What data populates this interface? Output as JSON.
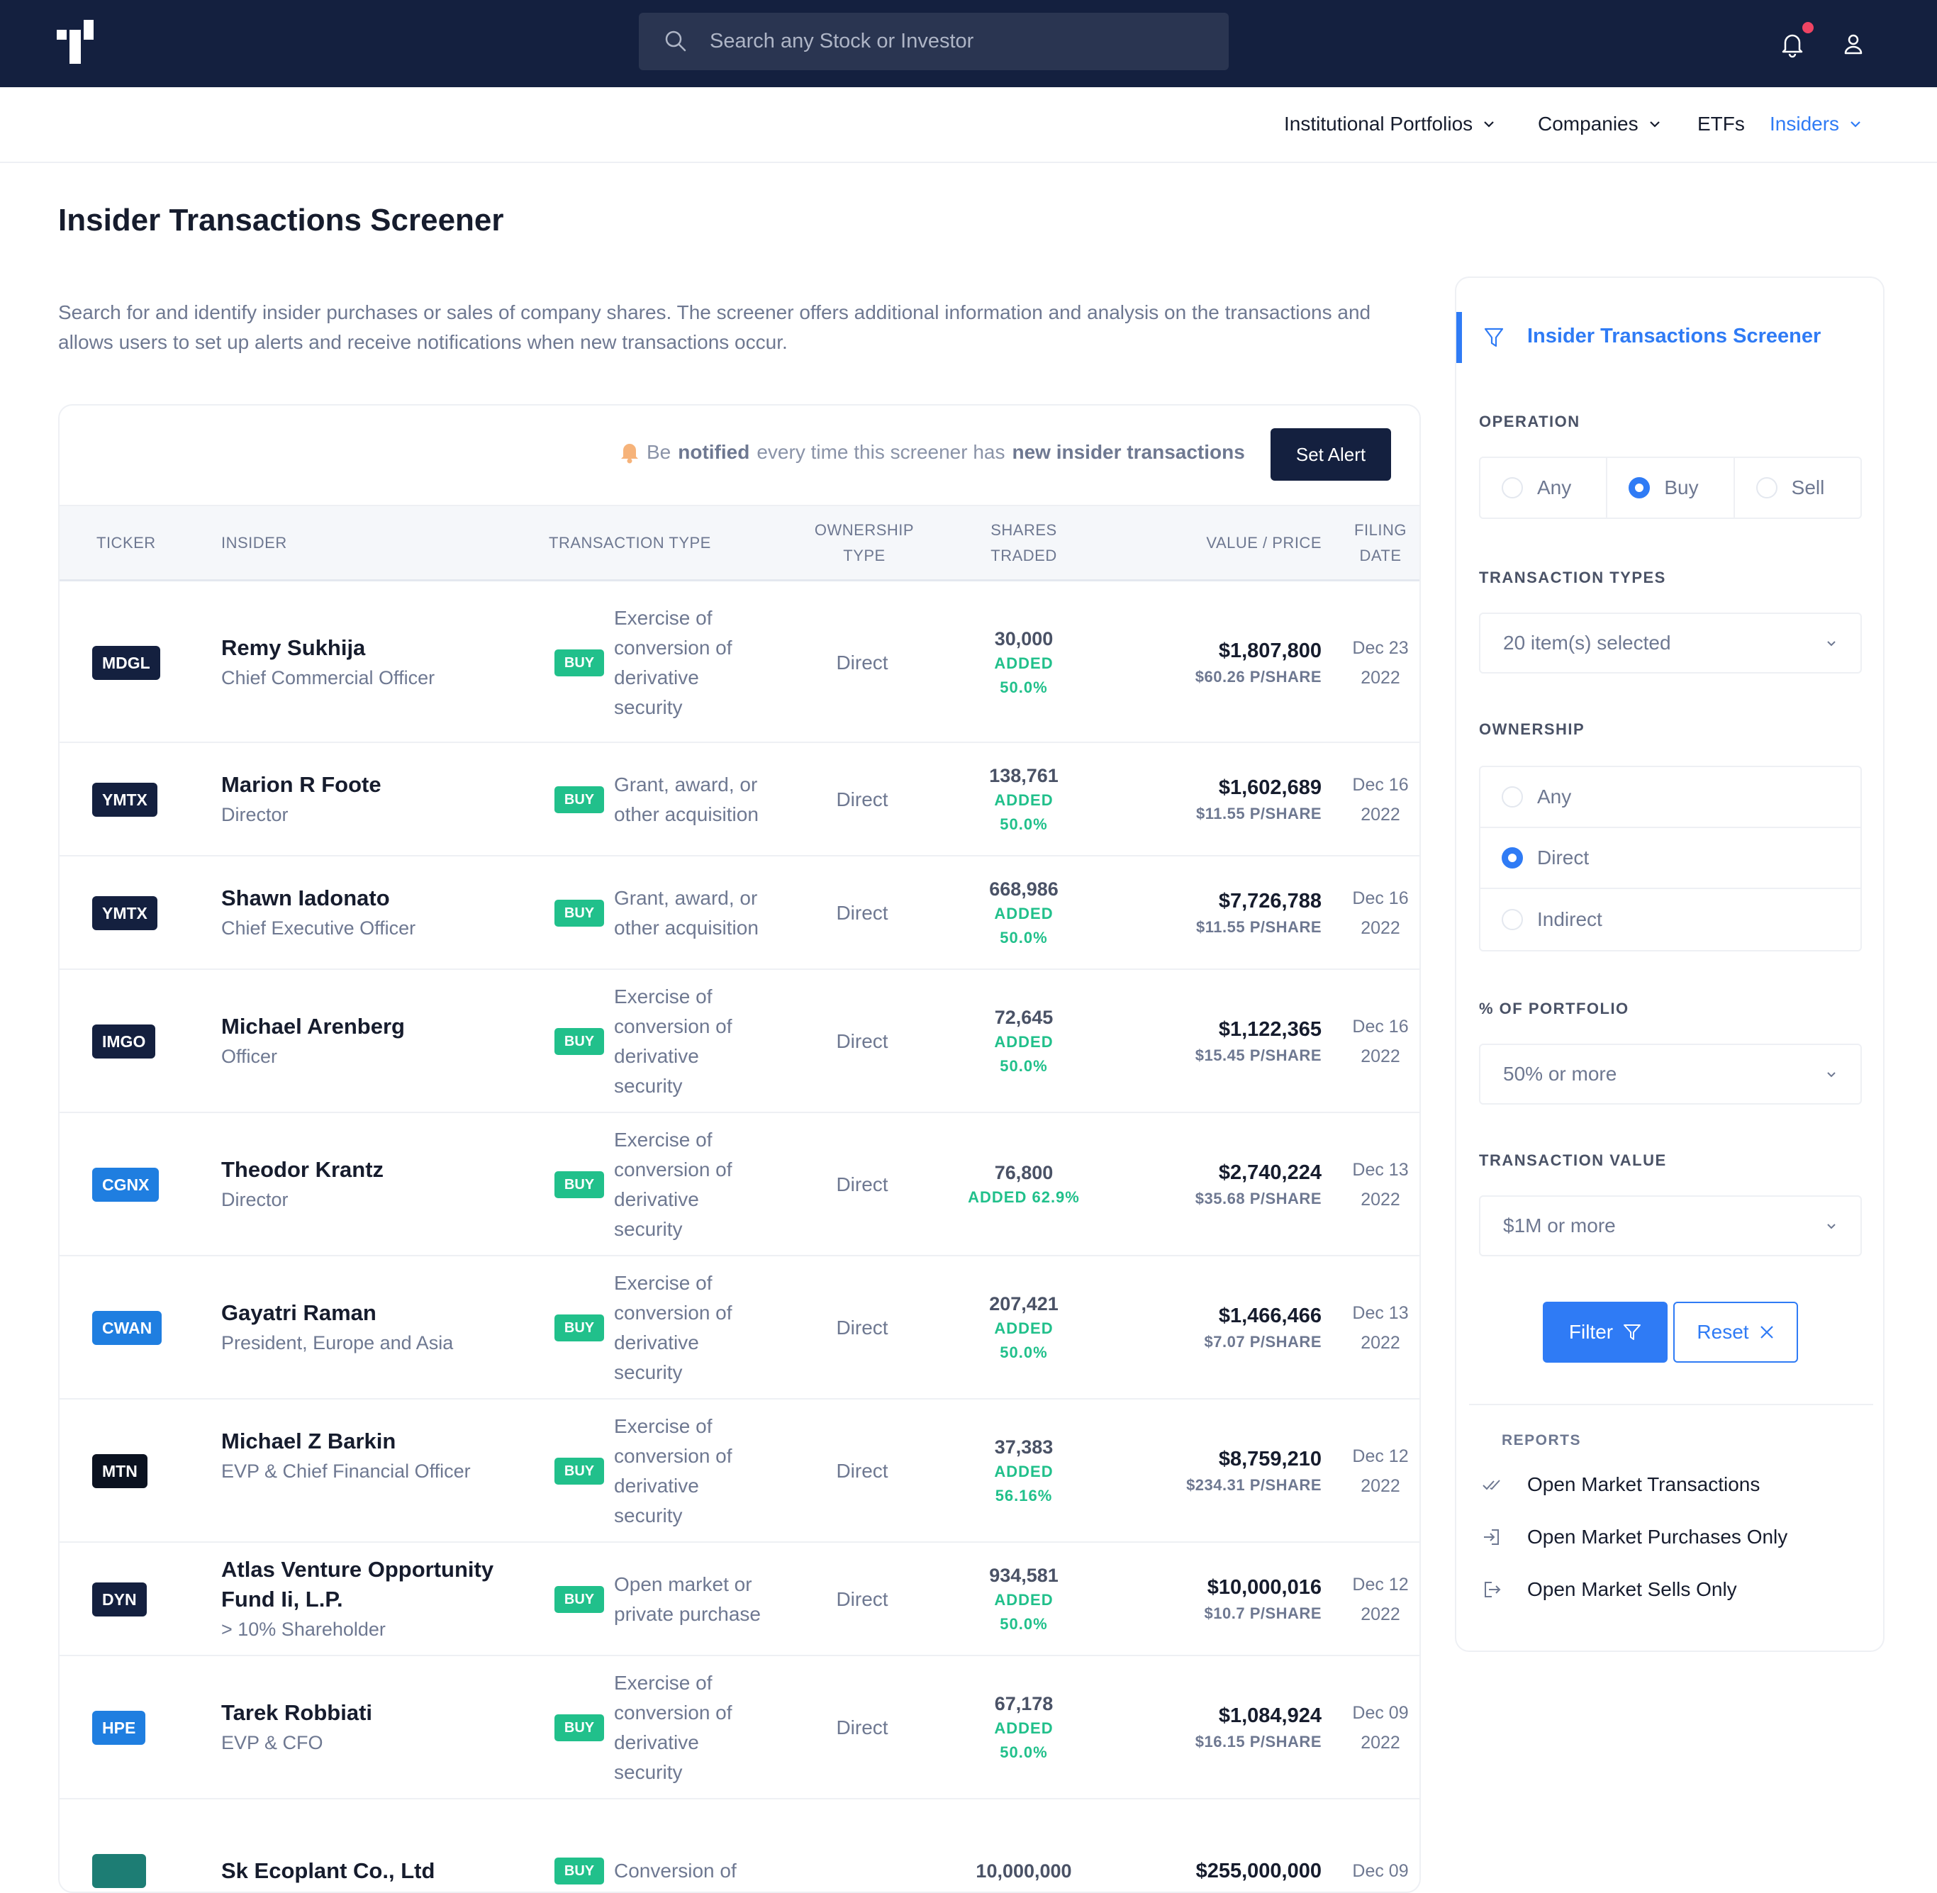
{
  "header": {
    "search_placeholder": "Search any Stock or Investor",
    "icons": [
      "logo-icon",
      "search-icon",
      "bell-icon",
      "user-icon"
    ]
  },
  "nav": {
    "items": [
      {
        "label": "Institutional Portfolios",
        "dropdown": true
      },
      {
        "label": "Companies",
        "dropdown": true
      },
      {
        "label": "ETFs",
        "dropdown": false
      },
      {
        "label": "Insiders",
        "dropdown": true,
        "active": true
      }
    ]
  },
  "page": {
    "title": "Insider Transactions Screener",
    "intro": "Search for and identify insider purchases or sales of company shares. The screener offers additional information and analysis on the transactions and allows users to set up alerts and receive notifications when new transactions occur."
  },
  "alert": {
    "p1": "Be",
    "b1": "notified",
    "p2": "every time this screener has",
    "b2": "new insider transactions",
    "button": "Set Alert"
  },
  "table": {
    "headers": {
      "ticker": "TICKER",
      "insider": "INSIDER",
      "transaction_type": "TRANSACTION TYPE",
      "ownership_1": "OWNERSHIP",
      "ownership_2": "TYPE",
      "shares_1": "SHARES",
      "shares_2": "TRADED",
      "value": "VALUE / PRICE",
      "filing_1": "FILING",
      "filing_2": "DATE"
    },
    "rows": [
      {
        "ticker": "MDGL",
        "color": "#14203f",
        "name": "Remy Sukhija",
        "title": "Chief Commercial Officer",
        "type": "Exercise of conversion of derivative security",
        "ownership": "Direct",
        "shares": "30,000",
        "chg1": "ADDED",
        "chg2": "50.0%",
        "value": "$1,807,800",
        "price": "$60.26 P/SHARE",
        "date1": "Dec 23",
        "date2": "2022"
      },
      {
        "ticker": "YMTX",
        "color": "#14203f",
        "name": "Marion R Foote",
        "title": "Director",
        "type": "Grant, award, or other acquisition",
        "ownership": "Direct",
        "shares": "138,761",
        "chg1": "ADDED",
        "chg2": "50.0%",
        "value": "$1,602,689",
        "price": "$11.55 P/SHARE",
        "date1": "Dec 16",
        "date2": "2022"
      },
      {
        "ticker": "YMTX",
        "color": "#14203f",
        "name": "Shawn Iadonato",
        "title": "Chief Executive Officer",
        "type": "Grant, award, or other acquisition",
        "ownership": "Direct",
        "shares": "668,986",
        "chg1": "ADDED",
        "chg2": "50.0%",
        "value": "$7,726,788",
        "price": "$11.55 P/SHARE",
        "date1": "Dec 16",
        "date2": "2022"
      },
      {
        "ticker": "IMGO",
        "color": "#14203f",
        "name": "Michael Arenberg",
        "title": "Officer",
        "type": "Exercise of conversion of derivative security",
        "ownership": "Direct",
        "shares": "72,645",
        "chg1": "ADDED",
        "chg2": "50.0%",
        "value": "$1,122,365",
        "price": "$15.45 P/SHARE",
        "date1": "Dec 16",
        "date2": "2022"
      },
      {
        "ticker": "CGNX",
        "color": "#1f7ee0",
        "name": "Theodor Krantz",
        "title": "Director",
        "type": "Exercise of conversion of derivative security",
        "ownership": "Direct",
        "shares": "76,800",
        "chg1": "ADDED 62.9%",
        "chg2": "",
        "value": "$2,740,224",
        "price": "$35.68 P/SHARE",
        "date1": "Dec 13",
        "date2": "2022"
      },
      {
        "ticker": "CWAN",
        "color": "#1f7ee0",
        "name": "Gayatri Raman",
        "title": "President, Europe and Asia",
        "type": "Exercise of conversion of derivative security",
        "ownership": "Direct",
        "shares": "207,421",
        "chg1": "ADDED",
        "chg2": "50.0%",
        "value": "$1,466,466",
        "price": "$7.07 P/SHARE",
        "date1": "Dec 13",
        "date2": "2022"
      },
      {
        "ticker": "MTN",
        "color": "#0b1220",
        "name": "Michael Z Barkin",
        "title": "EVP & Chief Financial Officer",
        "type": "Exercise of conversion of derivative security",
        "ownership": "Direct",
        "shares": "37,383",
        "chg1": "ADDED",
        "chg2": "56.16%",
        "value": "$8,759,210",
        "price": "$234.31 P/SHARE",
        "date1": "Dec 12",
        "date2": "2022"
      },
      {
        "ticker": "DYN",
        "color": "#14203f",
        "name": "Atlas Venture Opportunity Fund Ii, L.P.",
        "title": "> 10% Shareholder",
        "type": "Open market or private purchase",
        "ownership": "Direct",
        "shares": "934,581",
        "chg1": "ADDED",
        "chg2": "50.0%",
        "value": "$10,000,016",
        "price": "$10.7 P/SHARE",
        "date1": "Dec 12",
        "date2": "2022"
      },
      {
        "ticker": "HPE",
        "color": "#1f7ee0",
        "name": "Tarek Robbiati",
        "title": "EVP & CFO",
        "type": "Exercise of conversion of derivative security",
        "ownership": "Direct",
        "shares": "67,178",
        "chg1": "ADDED",
        "chg2": "50.0%",
        "value": "$1,084,924",
        "price": "$16.15 P/SHARE",
        "date1": "Dec 09",
        "date2": "2022"
      },
      {
        "ticker": "",
        "color": "#1d7d74",
        "name": "Sk Ecoplant Co., Ltd",
        "title": "",
        "type": "Conversion of",
        "ownership": "",
        "shares": "10,000,000",
        "chg1": "",
        "chg2": "",
        "value": "$255,000,000",
        "price": "",
        "date1": "Dec 09",
        "date2": ""
      }
    ]
  },
  "sidebar": {
    "title": "Insider Transactions Screener",
    "operation": {
      "label": "OPERATION",
      "options": [
        "Any",
        "Buy",
        "Sell"
      ],
      "selected": "Buy"
    },
    "transaction_types": {
      "label": "TRANSACTION TYPES",
      "value": "20 item(s) selected"
    },
    "ownership": {
      "label": "OWNERSHIP",
      "options": [
        "Any",
        "Direct",
        "Indirect"
      ],
      "selected": "Direct"
    },
    "portfolio": {
      "label": "% OF PORTFOLIO",
      "value": "50% or more"
    },
    "transaction_value": {
      "label": "TRANSACTION VALUE",
      "value": "$1M or more"
    },
    "filter_label": "Filter",
    "reset_label": "Reset",
    "reports": {
      "label": "REPORTS",
      "items": [
        "Open Market Transactions",
        "Open Market Purchases Only",
        "Open Market Sells Only"
      ]
    }
  },
  "colors": {
    "navy": "#14203f",
    "accent": "#2f7bf5",
    "buy_green": "#21c08b",
    "notification": "#ef4463"
  }
}
